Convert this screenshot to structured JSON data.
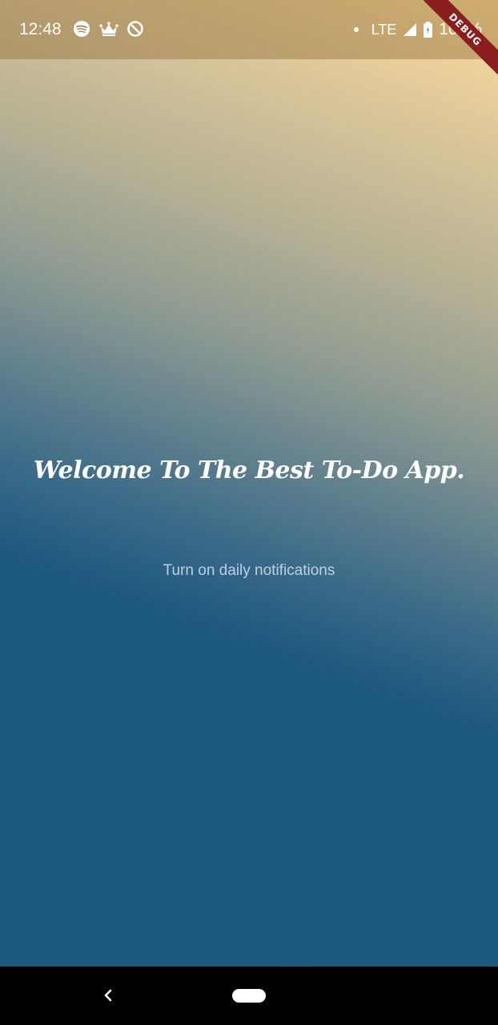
{
  "status_bar": {
    "time": "12:48",
    "notification_icons": [
      "spotify-icon",
      "crown-icon",
      "sync-icon"
    ],
    "network": "LTE",
    "battery": "100%"
  },
  "debug_banner": {
    "label": "DEBUG"
  },
  "main": {
    "welcome_text": "Welcome To The Best To-Do App.",
    "notification_link": "Turn on daily notifications"
  },
  "nav_bar": {
    "icons": [
      "back-icon",
      "home-pill-icon"
    ]
  },
  "colors": {
    "gradient_top": "#ffdc9c",
    "gradient_bottom": "#1c577f",
    "link_text": "#bcd0e0",
    "debug_ribbon": "#8a1e1e"
  }
}
